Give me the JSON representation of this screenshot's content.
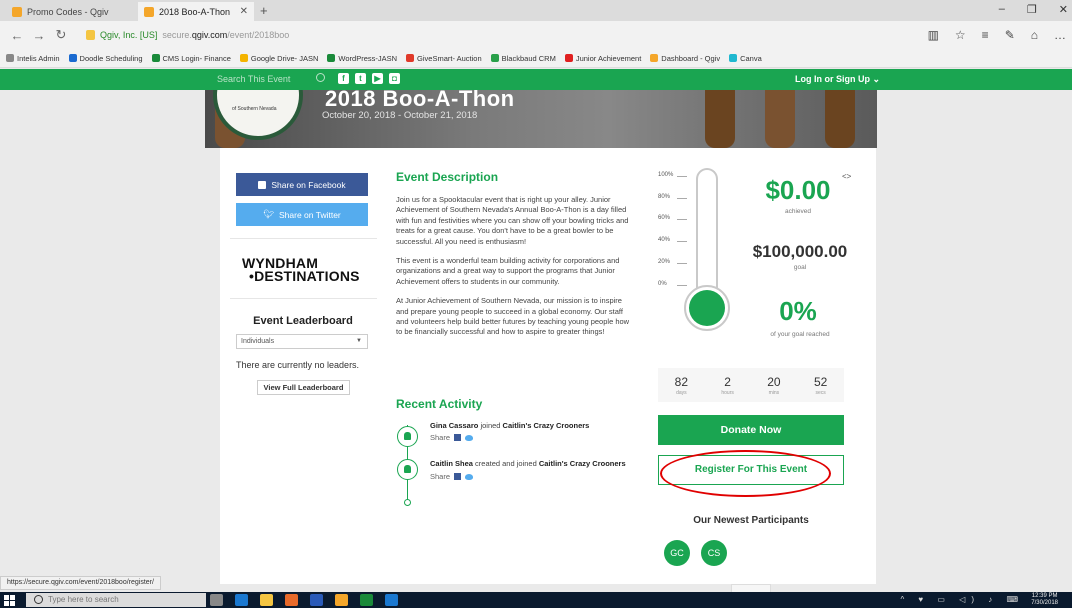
{
  "browser": {
    "tabs": [
      {
        "title": "Promo Codes - Qgiv",
        "active": false
      },
      {
        "title": "2018 Boo-A-Thon",
        "active": true
      }
    ],
    "new_tab": "+",
    "url_org": "Qgiv, Inc. [US]",
    "url_host": "secure.",
    "url_domain": "qgiv.com",
    "url_path": "/event/2018boo",
    "bookmarks": [
      {
        "label": "Intelis Admin",
        "color": "#888888"
      },
      {
        "label": "Doodle Scheduling",
        "color": "#1a6ad0"
      },
      {
        "label": "CMS Login- Finance",
        "color": "#1a8a3a"
      },
      {
        "label": "Google Drive- JASN",
        "color": "#f4b400"
      },
      {
        "label": "WordPress-JASN",
        "color": "#1a8a3a"
      },
      {
        "label": "GiveSmart- Auction",
        "color": "#e03a2a"
      },
      {
        "label": "Blackbaud CRM",
        "color": "#2aa04a"
      },
      {
        "label": "Junior Achievement",
        "color": "#e02020"
      },
      {
        "label": "Dashboard - Qgiv",
        "color": "#f4a62a"
      },
      {
        "label": "Canva",
        "color": "#20b8d0"
      }
    ],
    "status_url": "https://secure.qgiv.com/event/2018boo/register/"
  },
  "site": {
    "search_placeholder": "Search This Event",
    "login": "Log In or Sign Up"
  },
  "hero": {
    "title": "2018 Boo-A-Thon",
    "dates": "October 20, 2018 - October 21, 2018",
    "logo_text": "of Southern Nevada"
  },
  "sidebar": {
    "share_facebook": "Share on Facebook",
    "share_twitter": "Share on Twitter",
    "sponsor_line1": "WYNDHAM",
    "sponsor_line2": "•DESTINATIONS",
    "leaderboard_title": "Event Leaderboard",
    "leaderboard_select": "Individuals",
    "leaderboard_empty": "There are currently no leaders.",
    "leaderboard_button": "View Full Leaderboard"
  },
  "description": {
    "title": "Event Description",
    "paragraphs": [
      "Join us for a Spooktacular event that is right up your alley. Junior Achievement of Southern Nevada's Annual Boo-A-Thon is a day filled with fun and festivities where you can show off your bowling tricks and treats for a great cause. You don't have to be a great bowler to be successful. All you need is enthusiasm!",
      "This event is a wonderful team building activity for corporations and organizations and a great way to support the programs that Junior Achievement offers to students in our community.",
      "At Junior Achievement of Southern Nevada, our mission is to inspire and prepare young people to succeed in a global economy. Our staff and volunteers help build better futures by teaching young people how to be financially successful and how to aspire to greater things!"
    ]
  },
  "activity": {
    "title": "Recent Activity",
    "items": [
      {
        "name": "Gina Cassaro",
        "action": " joined ",
        "team": "Caitlin's Crazy Crooners",
        "share": "Share"
      },
      {
        "name": "Caitlin Shea",
        "action": " created and joined ",
        "team": "Caitlin's Crazy Crooners",
        "share": "Share"
      }
    ]
  },
  "progress": {
    "scale": [
      "100%",
      "80%",
      "60%",
      "40%",
      "20%",
      "0%"
    ],
    "raised": "$0.00",
    "raised_label": "achieved",
    "goal": "$100,000.00",
    "goal_label": "goal",
    "percent": "0%",
    "percent_label": "of your goal reached",
    "fraction_filled": 0
  },
  "countdown": [
    {
      "value": "82",
      "unit": "days"
    },
    {
      "value": "2",
      "unit": "hours"
    },
    {
      "value": "20",
      "unit": "mins"
    },
    {
      "value": "52",
      "unit": "secs"
    }
  ],
  "actions": {
    "donate": "Donate Now",
    "register": "Register For This Event"
  },
  "participants": {
    "title": "Our Newest Participants",
    "initials": [
      "GC",
      "CS"
    ]
  },
  "taskbar": {
    "search_placeholder": "Type here to search",
    "time": "12:39 PM",
    "date": "7/30/2018"
  },
  "colors": {
    "brand_green": "#1aa551",
    "facebook": "#3b5998",
    "twitter": "#55acee",
    "annotation_red": "#e00000"
  }
}
